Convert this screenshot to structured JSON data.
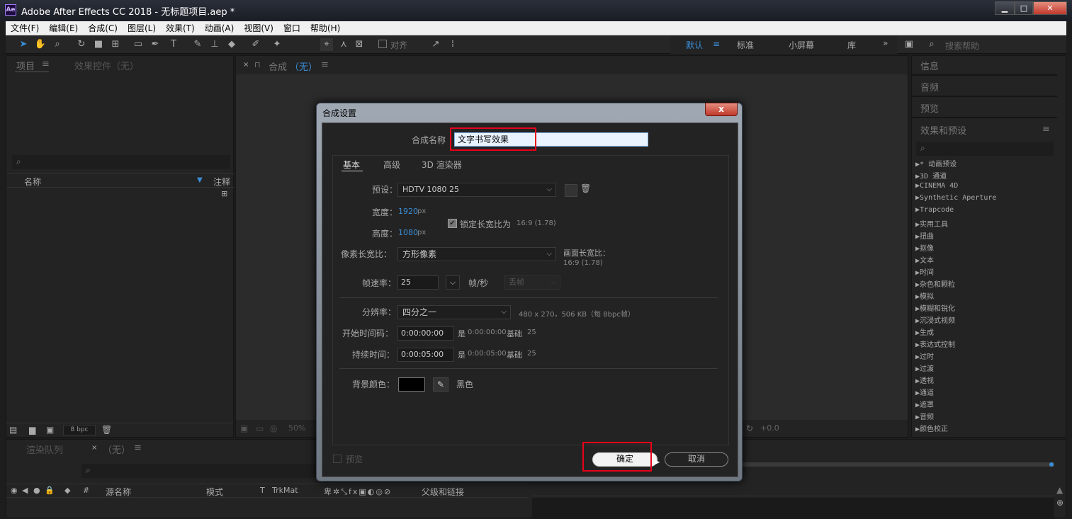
{
  "window": {
    "title": "Adobe After Effects CC 2018 - 无标题项目.aep *",
    "logo": "Ae",
    "min": "▁",
    "max": "□",
    "close": "✕"
  },
  "menu": [
    "文件(F)",
    "编辑(E)",
    "合成(C)",
    "图层(L)",
    "效果(T)",
    "动画(A)",
    "视图(V)",
    "窗口",
    "帮助(H)"
  ],
  "toolbar": {
    "align_label": "对齐",
    "workspaces": [
      "默认",
      "标准",
      "小屏幕",
      "库"
    ],
    "more": "»",
    "search_placeholder": "搜索帮助"
  },
  "project_panel": {
    "tab_project": "项目",
    "tab_effects": "效果控件（无）",
    "col_name": "名称",
    "col_comment": "注释",
    "bpc": "8 bpc"
  },
  "comp_panel": {
    "tab_label": "合成",
    "tab_none": "（无）",
    "zoom": "50%",
    "offset": "+0.0"
  },
  "right_panel": {
    "info": "信息",
    "audio": "音频",
    "preview": "预览",
    "effects_presets": "效果和预设",
    "items": [
      "* 动画预设",
      "3D 通道",
      "CINEMA 4D",
      "Synthetic Aperture",
      "Trapcode",
      "实用工具",
      "扭曲",
      "抠像",
      "文本",
      "时间",
      "杂色和颗粒",
      "模拟",
      "模糊和锐化",
      "沉浸式视频",
      "生成",
      "表达式控制",
      "过时",
      "过渡",
      "透视",
      "通道",
      "遮罩",
      "音频",
      "颜色校正"
    ]
  },
  "timeline": {
    "tab_render": "渲染队列",
    "tab_none": "（无）",
    "col_source": "源名称",
    "col_mode": "模式",
    "col_t": "T",
    "col_trkmat": "TrkMat",
    "col_parent": "父级和链接",
    "col_hash": "#"
  },
  "dialog": {
    "title": "合成设置",
    "close": "x",
    "comp_name_label": "合成名称",
    "comp_name_value": "文字书写效果",
    "tabs": [
      "基本",
      "高级",
      "3D 渲染器"
    ],
    "preset_label": "预设：",
    "preset_value": "HDTV 1080 25",
    "width_label": "宽度：",
    "width_value": "1920",
    "height_label": "高度：",
    "height_value": "1080",
    "px": "px",
    "lock_label": "锁定长宽比为",
    "lock_ratio": "16:9 (1.78)",
    "pixel_aspect_label": "像素长宽比：",
    "pixel_aspect_value": "方形像素",
    "frame_aspect_label": "画面长宽比：",
    "frame_aspect_value": "16:9 (1.78)",
    "fps_label": "帧速率：",
    "fps_value": "25",
    "fps_unit": "帧/秒",
    "drop_frame": "丢帧",
    "resolution_label": "分辨率：",
    "resolution_value": "四分之一",
    "resolution_info": "480 x 270，506 KB（每 8bpc帧）",
    "start_tc_label": "开始时间码：",
    "start_tc_value": "0:00:00:00",
    "start_tc_info_is": "是",
    "start_tc_info": "0:00:00:00",
    "base_label": "基础",
    "base_value": "25",
    "duration_label": "持续时间：",
    "duration_value": "0:00:05:00",
    "duration_info": "0:00:05:00",
    "bg_label": "背景颜色：",
    "bg_color_name": "黑色",
    "bg_color": "#000000",
    "preview_label": "预览",
    "ok": "确定",
    "cancel": "取消"
  },
  "colors": {
    "accent": "#3a8ed8",
    "highlight": "#e8001a"
  }
}
